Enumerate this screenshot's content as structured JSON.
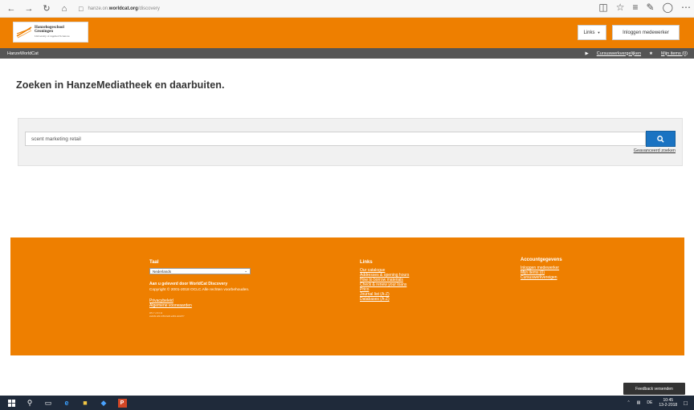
{
  "browser": {
    "address_prefix": "hanze.on.",
    "address_domain": "worldcat.org",
    "address_path": "/discovery"
  },
  "header": {
    "logo_line1": "Hanzehogeschool",
    "logo_line2": "Groningen",
    "logo_line3": "University of Applied Sciences",
    "links_button": "Links",
    "login_button": "Inloggen medewerker"
  },
  "subnav": {
    "left": "HanzeWorldCat",
    "right_link1": "Cursuswerkvergelijken",
    "right_link2": "Mijn items (0)"
  },
  "main": {
    "heading": "Zoeken in HanzeMediatheek en daarbuiten.",
    "search_value": "scent marketing retail",
    "advanced_link": "Geavanceerd zoeken"
  },
  "footer": {
    "taal": {
      "title": "Taal",
      "selected": "Nederlands",
      "powered": "Aan u geleverd door WorldCat Discovery",
      "copyright": "Copyright © 2001-2018 OCLC.Alle rechten voorbehouden.",
      "privacy": "Privacybeleid",
      "terms": "Algemene voorwaarden",
      "tiny1": "WC-7 v-8.3.12",
      "tiny2": "2a3c8b-fa5f-4358-8a68-a4f92 ab02077"
    },
    "links": {
      "title": "Links",
      "items": [
        "Our catalogue",
        "Addresses & opening hours",
        "How to borrow materials",
        "Check & renew your loans",
        "Prico",
        "Journal list (A-Z)",
        "Databases (A-Z)"
      ]
    },
    "account": {
      "title": "Accountgegevens",
      "items": [
        "Inloggen medewerker",
        "Mijn items (0)",
        "Cursuswerkvereigen"
      ]
    }
  },
  "feedback": "Feedback versenden",
  "taskbar": {
    "lang": "DE",
    "time": "10:45",
    "date": "13-2-2018"
  }
}
